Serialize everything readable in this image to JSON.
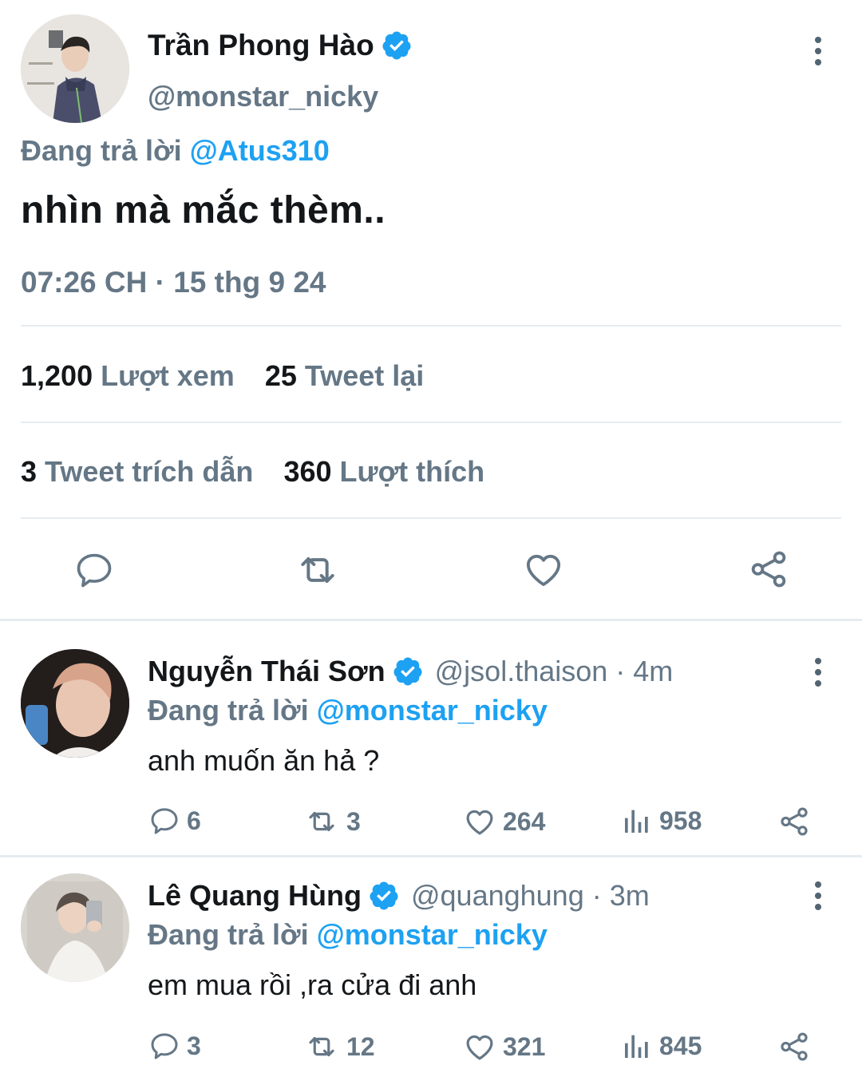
{
  "main_tweet": {
    "author_name": "Trần Phong Hào",
    "author_handle": "@monstar_nicky",
    "replying_prefix": "Đang trả lời",
    "replying_to": "@Atus310",
    "text": "nhìn mà mắc thèm..",
    "timestamp": "07:26 CH · 15 thg 9 24",
    "views_count": "1,200",
    "views_label": "Lượt xem",
    "retweets_count": "25",
    "retweets_label": "Tweet lại",
    "quotes_count": "3",
    "quotes_label": "Tweet trích dẫn",
    "likes_count": "360",
    "likes_label": "Lượt thích"
  },
  "replies": [
    {
      "author_name": "Nguyễn Thái Sơn",
      "author_handle": "@jsol.thaison · 4m",
      "replying_prefix": "Đang trả lời",
      "replying_to": "@monstar_nicky",
      "text": "anh muốn ăn hả ?",
      "reply_count": "6",
      "retweet_count": "3",
      "like_count": "264",
      "view_count": "958"
    },
    {
      "author_name": "Lê Quang Hùng",
      "author_handle": "@quanghung · 3m",
      "replying_prefix": "Đang trả lời",
      "replying_to": "@monstar_nicky",
      "text": "em mua rồi ,ra cửa đi anh",
      "reply_count": "3",
      "retweet_count": "12",
      "like_count": "321",
      "view_count": "845"
    }
  ],
  "colors": {
    "accent": "#1da1f2",
    "text_primary": "#14171a",
    "text_secondary": "#657786",
    "divider": "#e6ecf0"
  }
}
